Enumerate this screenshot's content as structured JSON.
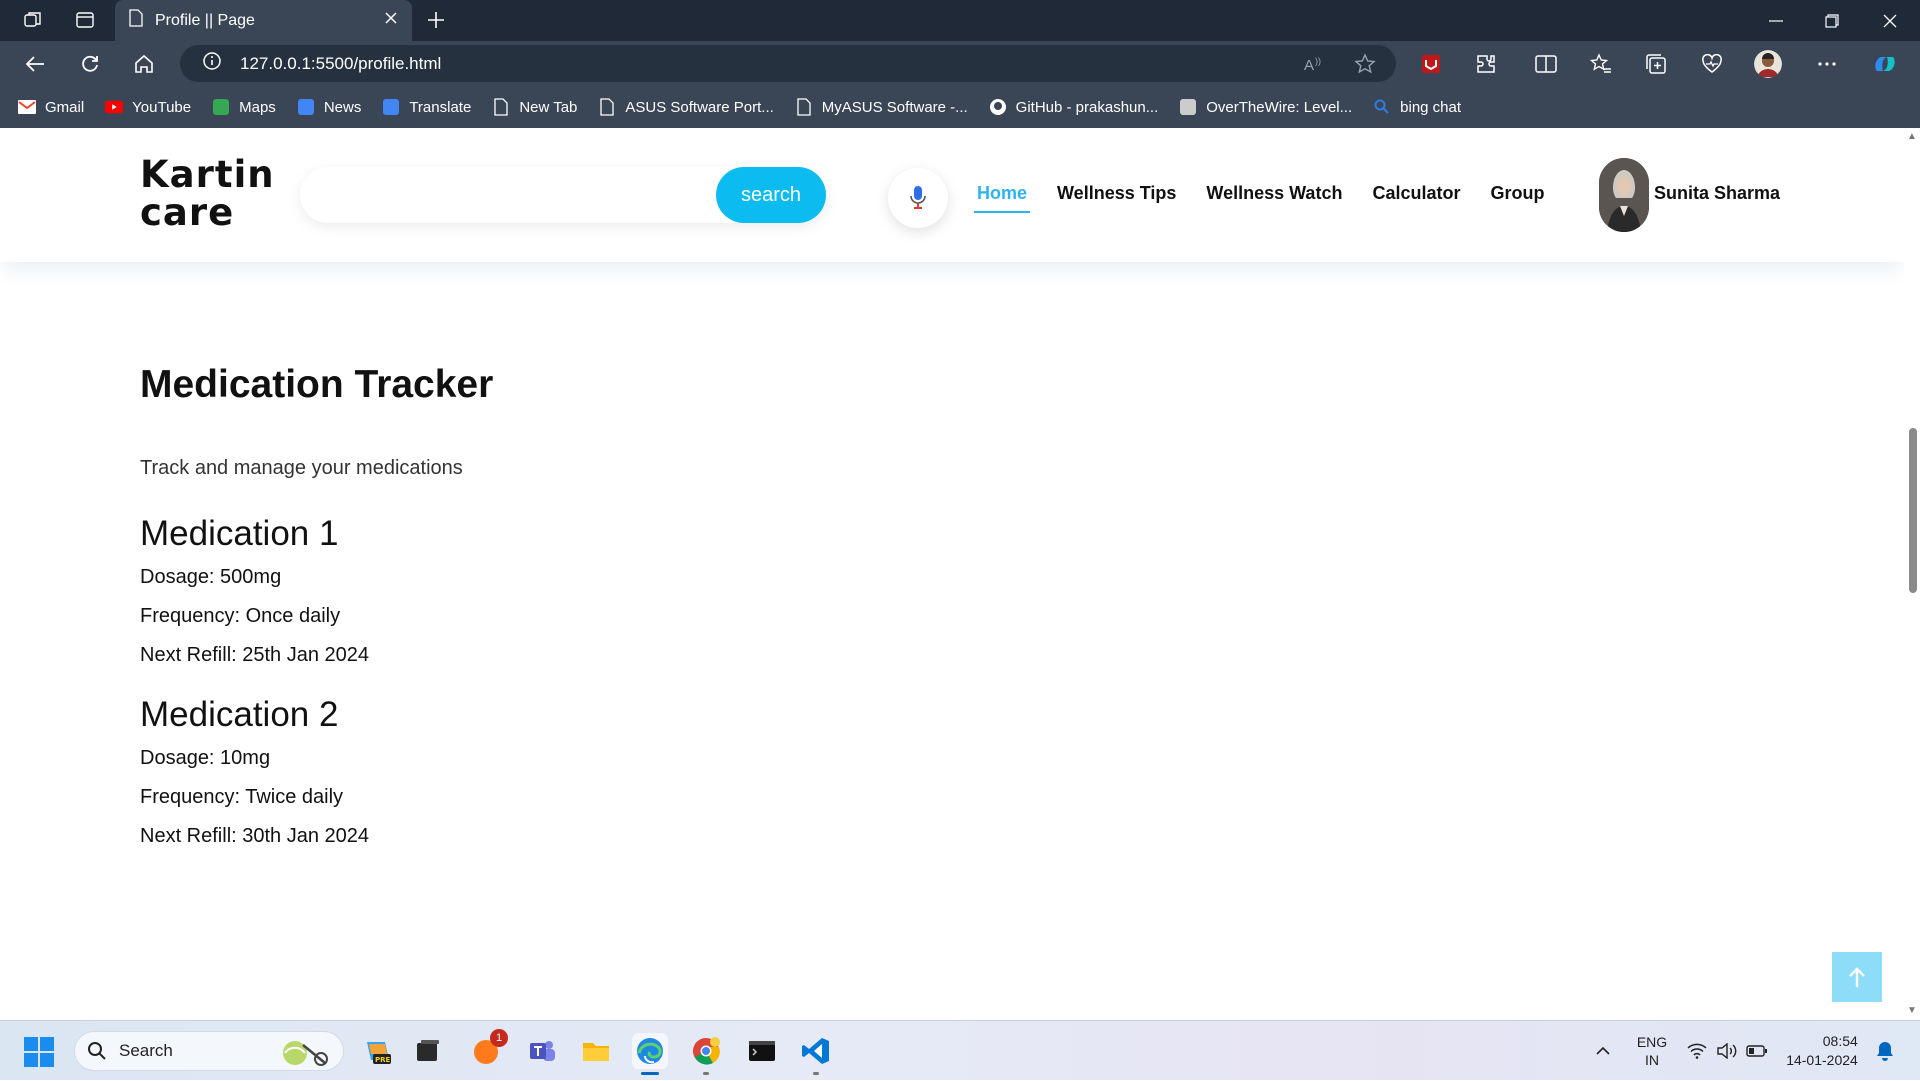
{
  "browser": {
    "tab_title": "Profile || Page",
    "url": "127.0.0.1:5500/profile.html",
    "bookmarks": [
      {
        "label": "Gmail",
        "icon": "gmail-icon",
        "color": "#ea4335"
      },
      {
        "label": "YouTube",
        "icon": "youtube-icon",
        "color": "#ff0000"
      },
      {
        "label": "Maps",
        "icon": "maps-icon",
        "color": "#34a853"
      },
      {
        "label": "News",
        "icon": "news-icon",
        "color": "#4285f4"
      },
      {
        "label": "Translate",
        "icon": "translate-icon",
        "color": "#4285f4"
      },
      {
        "label": "New Tab",
        "icon": "page-icon",
        "color": "#ffffff"
      },
      {
        "label": "ASUS Software Port...",
        "icon": "page-icon",
        "color": "#ffffff"
      },
      {
        "label": "MyASUS Software -...",
        "icon": "page-icon",
        "color": "#ffffff"
      },
      {
        "label": "GitHub - prakashun...",
        "icon": "github-icon",
        "color": "#ffffff"
      },
      {
        "label": "OverTheWire: Level...",
        "icon": "overthewire-icon",
        "color": "#cccccc"
      },
      {
        "label": "bing chat",
        "icon": "bing-search-icon",
        "color": "#2f7de1"
      }
    ]
  },
  "site": {
    "logo_line1": "Kartin",
    "logo_line2": "care",
    "search_placeholder": "",
    "search_button": "search",
    "nav": [
      {
        "label": "Home",
        "active": true
      },
      {
        "label": "Wellness Tips",
        "active": false
      },
      {
        "label": "Wellness Watch",
        "active": false
      },
      {
        "label": "Calculator",
        "active": false
      },
      {
        "label": "Group",
        "active": false
      }
    ],
    "user_name": "Sunita Sharma",
    "accent_color": "#0cbcf0"
  },
  "main": {
    "title": "Medication Tracker",
    "subtitle": "Track and manage your medications",
    "medications": [
      {
        "name": "Medication 1",
        "dosage": "Dosage: 500mg",
        "frequency": "Frequency: Once daily",
        "refill": "Next Refill: 25th Jan 2024"
      },
      {
        "name": "Medication 2",
        "dosage": "Dosage: 10mg",
        "frequency": "Frequency: Twice daily",
        "refill": "Next Refill: 30th Jan 2024"
      }
    ]
  },
  "taskbar": {
    "search_label": "Search",
    "notification_count": "1",
    "lang_line1": "ENG",
    "lang_line2": "IN",
    "time": "08:54",
    "date": "14-01-2024"
  }
}
